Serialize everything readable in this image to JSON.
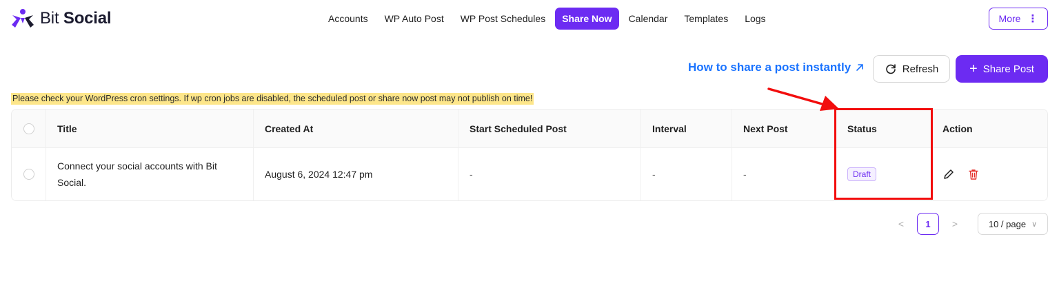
{
  "brand": {
    "name_regular": "Bit",
    "name_bold": "Social",
    "logo_icon": "bit-social-logo-icon",
    "accent_color": "#6c2bf2"
  },
  "nav": {
    "items": [
      {
        "label": "Accounts",
        "active": false
      },
      {
        "label": "WP Auto Post",
        "active": false
      },
      {
        "label": "WP Post Schedules",
        "active": false
      },
      {
        "label": "Share Now",
        "active": true
      },
      {
        "label": "Calendar",
        "active": false
      },
      {
        "label": "Templates",
        "active": false
      },
      {
        "label": "Logs",
        "active": false
      }
    ],
    "more_label": "More",
    "more_icon": "vertical-dots-icon"
  },
  "toolbar": {
    "howto_label": "How to share a post instantly",
    "howto_icon": "external-arrow-icon",
    "refresh_label": "Refresh",
    "refresh_icon": "refresh-icon",
    "share_label": "Share Post",
    "share_icon": "plus-icon"
  },
  "warning": {
    "text": "Please check your WordPress cron settings. If wp cron jobs are disabled, the scheduled post or share now post may not publish on time!",
    "highlight_color": "#fde68a"
  },
  "table": {
    "columns": [
      "Title",
      "Created At",
      "Start Scheduled Post",
      "Interval",
      "Next Post",
      "Status",
      "Action"
    ],
    "rows": [
      {
        "title": "Connect your social accounts with Bit Social.",
        "created_at": "August 6, 2024 12:47 pm",
        "start_scheduled_post": "-",
        "interval": "-",
        "next_post": "-",
        "status": "Draft",
        "actions": [
          "edit-icon",
          "delete-icon"
        ]
      }
    ]
  },
  "annotation": {
    "highlight_color": "#f20d0d"
  },
  "pagination": {
    "prev_label": "<",
    "current_page": "1",
    "next_label": ">",
    "page_size_label": "10 / page"
  }
}
